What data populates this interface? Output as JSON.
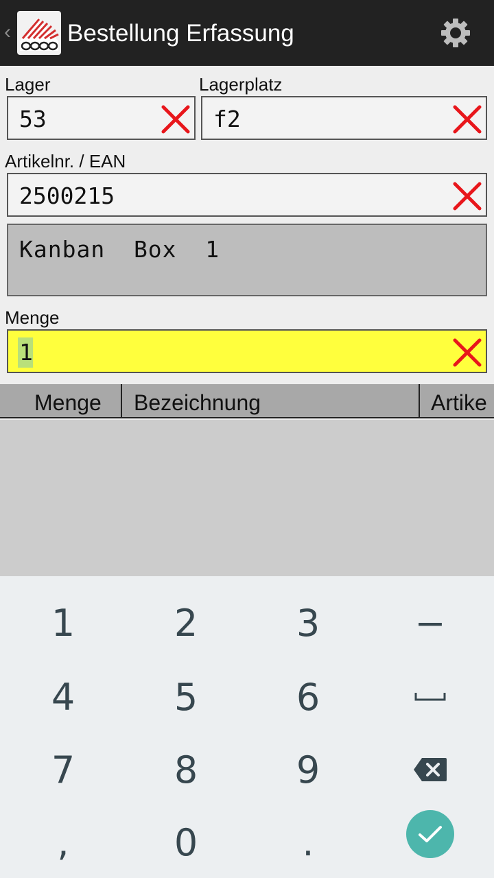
{
  "app": {
    "title": "Bestellung Erfassung",
    "up_caret": "‹"
  },
  "form": {
    "lager": {
      "label": "Lager",
      "value": "53"
    },
    "lagerplatz": {
      "label": "Lagerplatz",
      "value": "f2"
    },
    "artikel": {
      "label": "Artikelnr. / EAN",
      "value": "2500215"
    },
    "description": {
      "value": "Kanban  Box  1"
    },
    "menge": {
      "label": "Menge",
      "value": "1"
    }
  },
  "table": {
    "columns": [
      "Menge",
      "Bezeichnung",
      "Artike"
    ]
  },
  "keyboard": {
    "rows": [
      [
        "1",
        "2",
        "3",
        "−"
      ],
      [
        "4",
        "5",
        "6",
        "space"
      ],
      [
        "7",
        "8",
        "9",
        "backspace"
      ],
      [
        ",",
        "0",
        ".",
        "enter"
      ]
    ],
    "labels": {
      "k1": "1",
      "k2": "2",
      "k3": "3",
      "minus": "−",
      "k4": "4",
      "k5": "5",
      "k6": "6",
      "k7": "7",
      "k8": "8",
      "k9": "9",
      "comma": ",",
      "k0": "0",
      "period": "."
    }
  },
  "colors": {
    "actionbar": "#222222",
    "menge_highlight": "#ffff3d",
    "selection": "#b9e07a",
    "clear_red": "#e8161b",
    "enter_accent": "#4db6ac",
    "keyboard_bg": "#eceff1"
  },
  "icons": {
    "settings": "gear-icon",
    "clear": "clear-x-icon",
    "backspace": "backspace-icon",
    "enter": "checkmark-icon",
    "space": "space-bar-icon"
  }
}
